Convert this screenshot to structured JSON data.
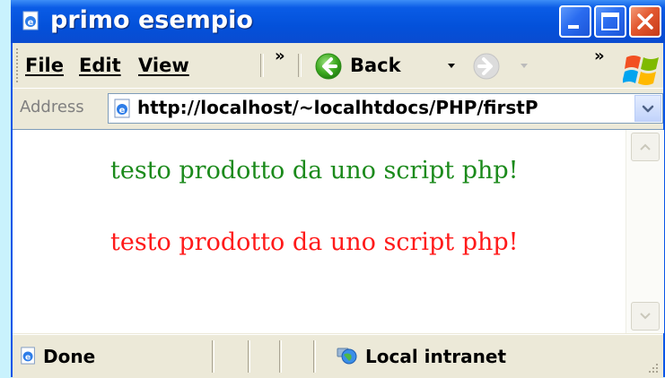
{
  "window": {
    "title": "primo esempio"
  },
  "menu": {
    "file": "File",
    "edit": "Edit",
    "view": "View",
    "overflow": "»"
  },
  "toolbar": {
    "back_label": "Back",
    "overflow": "»"
  },
  "address": {
    "label": "Address",
    "url": "http://localhost/~localhtdocs/PHP/firstP"
  },
  "page": {
    "line1": "testo prodotto da uno script php!",
    "line2": "testo prodotto da uno script php!"
  },
  "status": {
    "text": "Done",
    "zone": "Local intranet"
  },
  "colors": {
    "title_bar": "#0351da",
    "line1_text": "#1b8a1b",
    "line2_text": "#ff1a1a",
    "background": "#c9f2fd"
  },
  "icons": {
    "title": "ie-page-icon",
    "back": "back-arrow-icon",
    "forward": "forward-arrow-icon",
    "logo": "windows-logo-icon",
    "address": "ie-page-icon",
    "status_done": "ie-page-icon",
    "zone": "intranet-globe-icon"
  }
}
